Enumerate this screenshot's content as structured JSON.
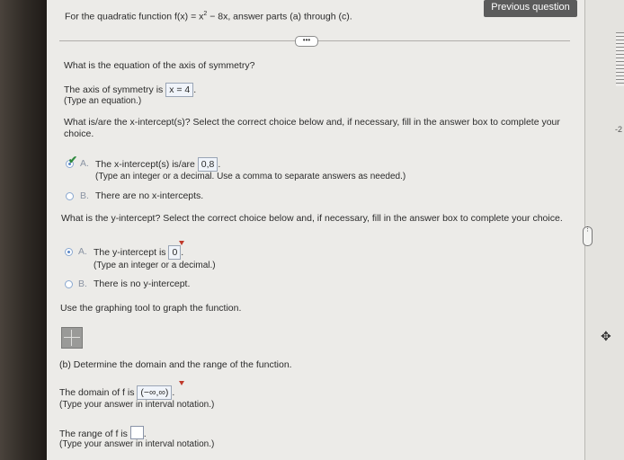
{
  "header": {
    "prompt_pre": "For the quadratic function f(x) = x",
    "prompt_exp": "2",
    "prompt_post": " − 8x, answer parts (a) through (c).",
    "prev_button": "Previous question",
    "expand_dots": "•••"
  },
  "axis": {
    "question": "What is the equation of the axis of symmetry?",
    "label": "The axis of symmetry is",
    "answer": "x = 4",
    "hint": "(Type an equation.)"
  },
  "xint": {
    "question_line1": "What is/are the x-intercept(s)? Select the correct choice below and, if necessary, fill in the answer box to complete your",
    "question_line2": "choice.",
    "a_letter": "A.",
    "a_label": "The x-intercept(s) is/are",
    "a_answer": "0,8",
    "a_hint": "(Type an integer or a decimal. Use a comma to separate answers as needed.)",
    "b_letter": "B.",
    "b_label": "There are no x-intercepts."
  },
  "yint": {
    "question": "What is the y-intercept? Select the correct choice below and, if necessary, fill in the answer box to complete your choice.",
    "a_letter": "A.",
    "a_label": "The y-intercept is",
    "a_answer": "0",
    "a_hint": "(Type an integer or a decimal.)",
    "b_letter": "B.",
    "b_label": "There is no y-intercept."
  },
  "graph": {
    "instruction": "Use the graphing tool to graph the function."
  },
  "part_b": {
    "heading": "(b) Determine the domain and the range of the function.",
    "domain_label": "The domain of f is",
    "domain_answer": "(−∞,∞)",
    "domain_hint": "(Type your answer in interval notation.)",
    "range_label": "The range of f is",
    "range_hint": "(Type your answer in interval notation.)"
  },
  "side": {
    "ruler_label": "-2",
    "scroll_dots": "⋮",
    "move_icon": "✥"
  }
}
